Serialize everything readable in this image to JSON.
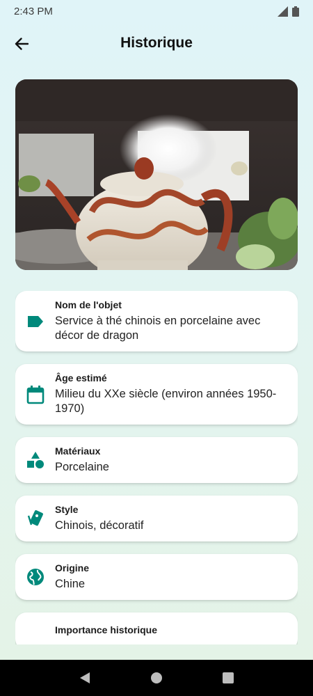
{
  "status_bar": {
    "time": "2:43 PM"
  },
  "header": {
    "title": "Historique"
  },
  "colors": {
    "accent": "#00897b"
  },
  "cards": [
    {
      "icon": "label-tag-icon",
      "label": "Nom de l'objet",
      "value": "Service à thé chinois en porcelaine avec décor de dragon"
    },
    {
      "icon": "calendar-icon",
      "label": "Âge estimé",
      "value": "Milieu du XXe siècle (environ années 1950-1970)"
    },
    {
      "icon": "shapes-icon",
      "label": "Matériaux",
      "value": "Porcelaine"
    },
    {
      "icon": "style-cards-icon",
      "label": "Style",
      "value": "Chinois, décoratif"
    },
    {
      "icon": "globe-icon",
      "label": "Origine",
      "value": "Chine"
    },
    {
      "icon": "history-icon",
      "label": "Importance historique",
      "value": ""
    }
  ]
}
